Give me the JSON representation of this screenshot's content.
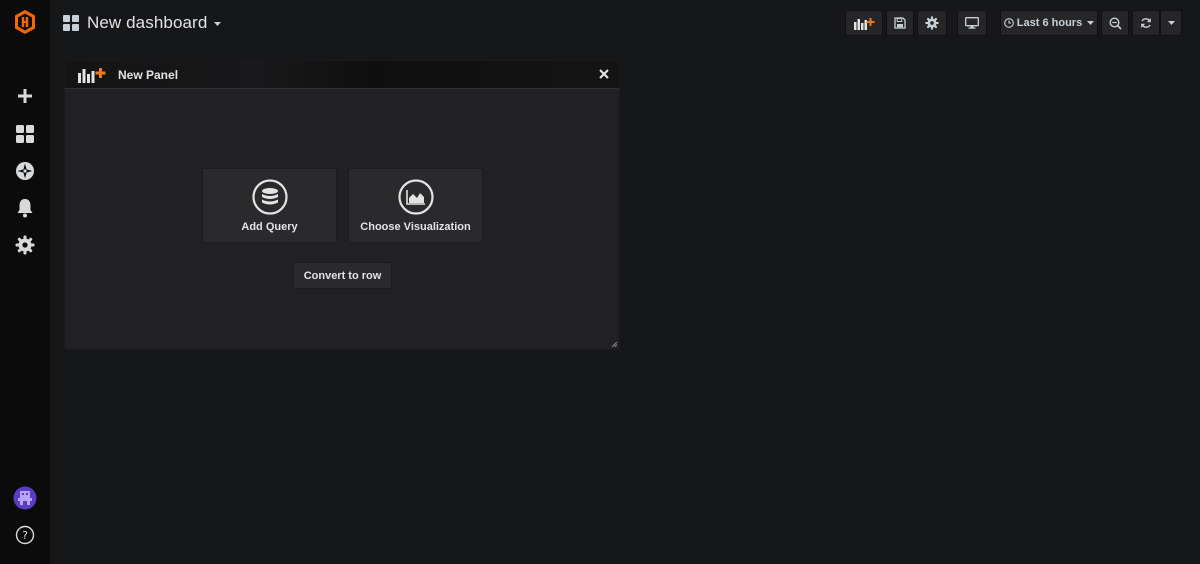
{
  "app": {
    "brand_color": "#f46800",
    "accent_color": "#eb7b18"
  },
  "sidebar": {
    "items": [
      {
        "name": "grafana-logo",
        "icon": "grafana-logo-icon"
      },
      {
        "name": "create",
        "icon": "plus-icon"
      },
      {
        "name": "dashboards",
        "icon": "dashboard-grid-icon"
      },
      {
        "name": "explore",
        "icon": "compass-icon"
      },
      {
        "name": "alerting",
        "icon": "bell-icon"
      },
      {
        "name": "configuration",
        "icon": "gear-icon"
      },
      {
        "name": "profile",
        "icon": "user-avatar-icon"
      },
      {
        "name": "help",
        "icon": "help-icon"
      }
    ]
  },
  "header": {
    "title": "New dashboard",
    "buttons": [
      {
        "name": "add-panel",
        "icon": "add-panel-icon"
      },
      {
        "name": "save-dashboard",
        "icon": "save-icon"
      },
      {
        "name": "dashboard-settings",
        "icon": "gear-icon"
      },
      {
        "name": "tv-mode",
        "icon": "monitor-icon"
      },
      {
        "name": "zoom-out",
        "icon": "zoom-out-icon"
      },
      {
        "name": "refresh",
        "icon": "refresh-icon"
      },
      {
        "name": "refresh-interval",
        "icon": "caret-down-icon"
      }
    ],
    "time_picker": {
      "label": "Last 6 hours",
      "icon": "clock-icon"
    }
  },
  "panel": {
    "title": "New Panel",
    "actions": [
      {
        "label": "Add Query",
        "icon": "database-icon"
      },
      {
        "label": "Choose Visualization",
        "icon": "area-chart-icon"
      }
    ],
    "convert_label": "Convert to row"
  }
}
